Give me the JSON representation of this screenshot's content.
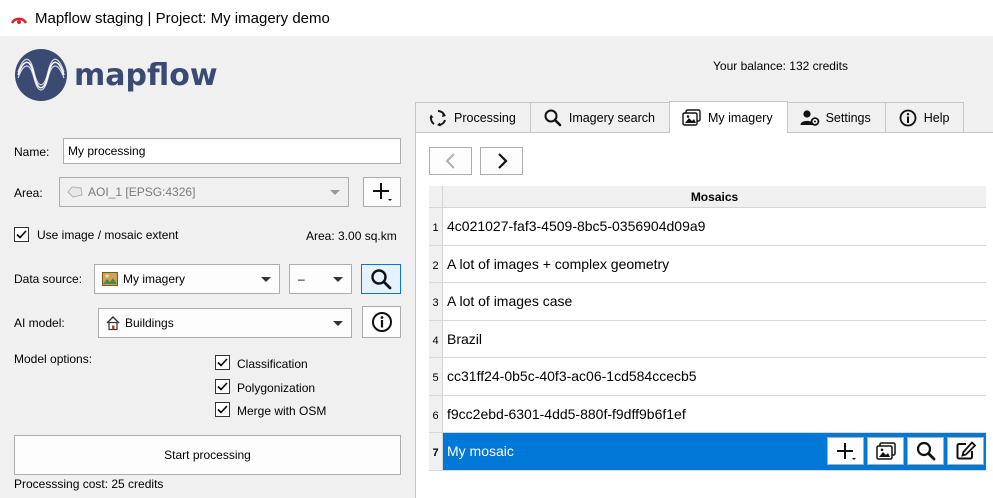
{
  "window": {
    "title": "Mapflow staging | Project: My imagery demo"
  },
  "logo": {
    "text": "mapflow"
  },
  "balance": {
    "text": "Your balance: 132 credits"
  },
  "form": {
    "name_label": "Name:",
    "name_value": "My processing",
    "area_label": "Area:",
    "area_value": "AOI_1 [EPSG:4326]",
    "use_extent_label": "Use image / mosaic extent",
    "use_extent_checked": true,
    "area_size": "Area: 3.00 sq.km",
    "data_source_label": "Data source:",
    "data_source_value": "My imagery",
    "data_source_secondary": "–",
    "ai_model_label": "AI model:",
    "ai_model_value": "Buildings",
    "model_options_label": "Model options:",
    "options": [
      {
        "label": "Classification",
        "checked": true
      },
      {
        "label": "Polygonization",
        "checked": true
      },
      {
        "label": "Merge with OSM",
        "checked": true
      }
    ],
    "start_label": "Start processing",
    "cost_text": "Processsing cost: 25 credits"
  },
  "tabs": [
    {
      "label": "Processing",
      "icon": "processing-icon",
      "active": false
    },
    {
      "label": "Imagery search",
      "icon": "search-icon",
      "active": false
    },
    {
      "label": "My imagery",
      "icon": "image-icon",
      "active": true
    },
    {
      "label": "Settings",
      "icon": "user-settings-icon",
      "active": false
    },
    {
      "label": "Help",
      "icon": "info-icon",
      "active": false
    }
  ],
  "mosaics": {
    "header": "Mosaics",
    "rows": [
      {
        "num": "1",
        "name": "4c021027-faf3-4509-8bc5-0356904d09a9"
      },
      {
        "num": "2",
        "name": "A lot of images + complex geometry"
      },
      {
        "num": "3",
        "name": "A lot of images case"
      },
      {
        "num": "4",
        "name": "Brazil"
      },
      {
        "num": "5",
        "name": "cc31ff24-0b5c-40f3-ac06-1cd584ccecb5"
      },
      {
        "num": "6",
        "name": "f9cc2ebd-6301-4dd5-880f-f9dff9b6f1ef"
      },
      {
        "num": "7",
        "name": "My mosaic",
        "selected": true
      }
    ]
  },
  "colors": {
    "accent": "#0078d7",
    "brand": "#3a4a72",
    "logo_red": "#d9232e"
  }
}
